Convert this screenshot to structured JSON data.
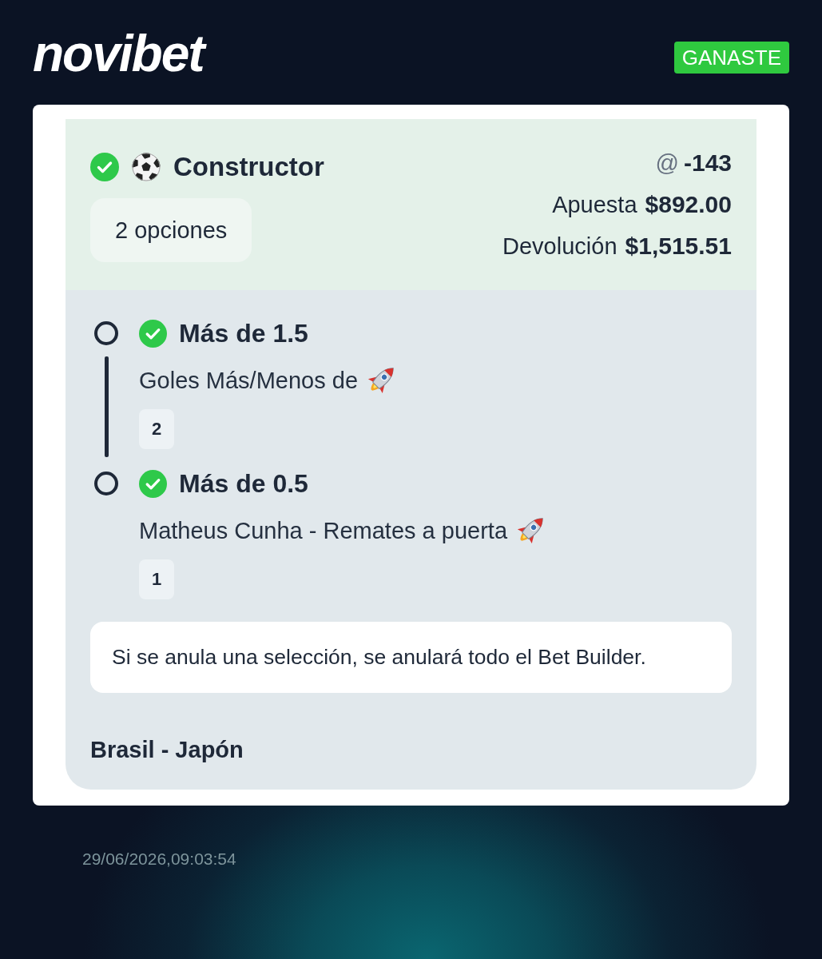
{
  "header": {
    "logo": "novibet",
    "status_badge": {
      "label": "GANASTE",
      "kind": "won"
    }
  },
  "bet": {
    "won": true,
    "title": "Constructor",
    "selections_label": "2 opciones",
    "odds_symbol": "@",
    "odds": "-143",
    "stake_label": "Apuesta",
    "stake": "$892.00",
    "return_label": "Devolución",
    "return": "$1,515.51"
  },
  "legs": [
    {
      "won": true,
      "title": "Más de 1.5",
      "market": "Goles Más/Menos de",
      "boosted": true,
      "number": "2"
    },
    {
      "won": true,
      "title": "Más de 0.5",
      "market": "Matheus Cunha - Remates a puerta",
      "boosted": true,
      "number": "1"
    }
  ],
  "notice": "Si se anula una selección, se anulará todo el Bet Builder.",
  "event": "Brasil - Japón",
  "timestamp": "29/06/2026,09:03:54"
}
